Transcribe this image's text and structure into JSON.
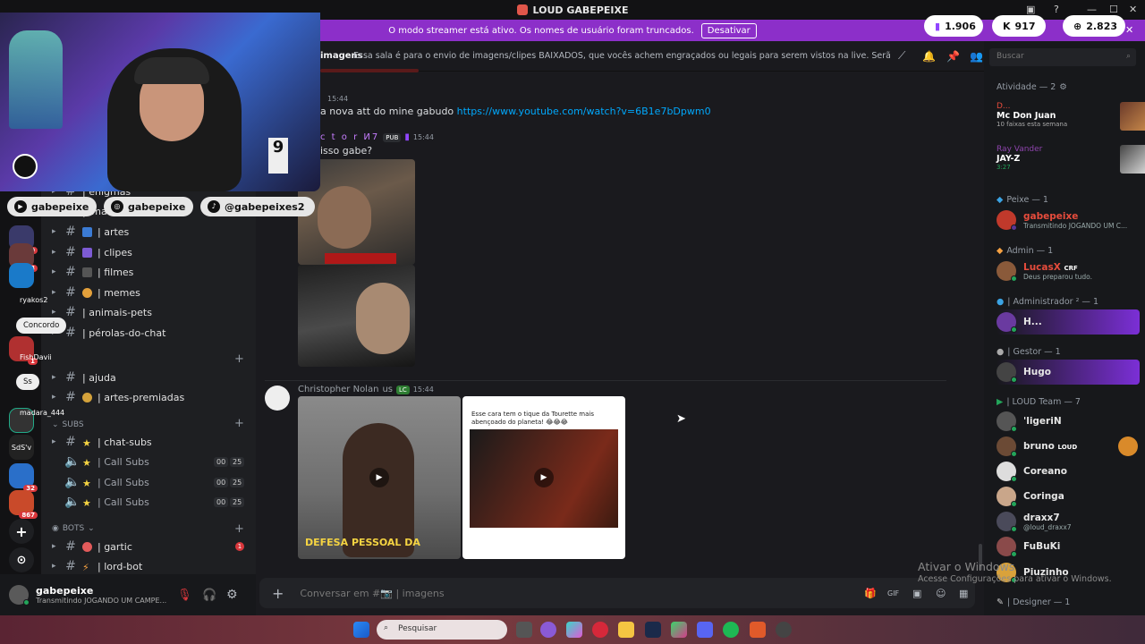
{
  "window": {
    "title": "LOUD GABEPEIXE"
  },
  "streamer_bar": {
    "message": "O modo streamer está ativo. Os nomes de usuário foram truncados.",
    "button": "Desativar"
  },
  "counters": [
    {
      "icon": "twitch-icon",
      "value": "1.906"
    },
    {
      "icon": "kick-icon",
      "value": "917"
    },
    {
      "icon": "globe-icon",
      "value": "2.823"
    }
  ],
  "channel_header": {
    "name": "imagens",
    "topic": "Essa sala é para o envio de imagens/clipes BAIXADOS, que vocês achem engraçados ou legais para serem vistos na live. Serão apagados prints de ou...",
    "search_placeholder": "Buscar"
  },
  "servers": {
    "badges": [
      "70",
      "113",
      "1",
      "32",
      "867"
    ],
    "labels": [
      "SdS'v"
    ]
  },
  "overlay": {
    "socials": [
      "gabepeixe",
      "gabepeixe",
      "@gabepeixes2"
    ],
    "chat": [
      {
        "user": "ryakos2"
      },
      {
        "text": "Concordo"
      },
      {
        "user": "FishDavii"
      },
      {
        "text": "Ss"
      },
      {
        "user": "madara_444"
      }
    ]
  },
  "channels": {
    "items": [
      {
        "name": "| enigmas"
      },
      {
        "name": "| ima..."
      },
      {
        "name": "| artes"
      },
      {
        "name": "| clipes"
      },
      {
        "name": "| filmes"
      },
      {
        "name": "| memes"
      },
      {
        "name": "| animais-pets"
      },
      {
        "name": "| pérolas-do-chat"
      },
      {
        "name": "| ajuda"
      },
      {
        "name": "| artes-premiadas"
      }
    ],
    "subs_category": "SUBS",
    "subs": [
      {
        "name": "| chat-subs"
      },
      {
        "name": "| Call Subs",
        "a": "00",
        "b": "25"
      },
      {
        "name": "| Call Subs",
        "a": "00",
        "b": "25"
      },
      {
        "name": "| Call Subs",
        "a": "00",
        "b": "25"
      }
    ],
    "bots_category": "BOTS",
    "bots": [
      {
        "name": "| gartic",
        "badge": "1"
      },
      {
        "name": "| lord-bot"
      }
    ]
  },
  "user": {
    "name": "gabepeixe",
    "status": "Transmitindo JOGANDO UM CAMPE..."
  },
  "messages": [
    {
      "time": "15:44",
      "text": "a nova att do mine gabudo ",
      "link": "https://www.youtube.com/watch?v=6B1e7bDpwm0"
    },
    {
      "author": "c t o r И7",
      "tag": "PUB",
      "time": "15:44",
      "text": "isso gabe?"
    },
    {
      "author": "Christopher Nolan",
      "suffix": "us",
      "tag": "LC",
      "time": "15:44",
      "image_caption": "Esse cara tem o tique da Tourette mais abençoado do planeta! 😂😂😂",
      "video_overlay": "DEFESA PESSOAL DA"
    }
  ],
  "composer": {
    "placeholder": "Conversar em #📷 | imagens"
  },
  "members": {
    "activity_title": "Atividade — 2",
    "activities": [
      {
        "name": "D...",
        "title": "Mc Don Juan",
        "sub": "10 faixas esta semana"
      },
      {
        "name": "Ray Vander",
        "title": "JAY-Z",
        "sub": "3:27"
      }
    ],
    "groups": [
      {
        "title": "Peixe — 1",
        "members": [
          {
            "name": "gabepeixe",
            "sub": "Transmitindo JOGANDO UM C...",
            "color": "#e74c3c"
          }
        ]
      },
      {
        "title": "Admin — 1",
        "members": [
          {
            "name": "LucasX",
            "tag": "CRF",
            "sub": "Deus preparou tudo.",
            "color": "#e74c3c"
          }
        ]
      },
      {
        "title": "| Administrador ² — 1",
        "members": [
          {
            "name": "H...",
            "color": "#ffffff"
          }
        ]
      },
      {
        "title": "| Gestor — 1",
        "members": [
          {
            "name": "Hugo",
            "color": "#ffffff"
          }
        ]
      },
      {
        "title": "| LOUD Team — 7",
        "members": [
          {
            "name": "'ligeriN",
            "color": "#dbdee1"
          },
          {
            "name": "bruno",
            "tag": "LOUD",
            "color": "#dbdee1"
          },
          {
            "name": "Coreano",
            "color": "#dbdee1"
          },
          {
            "name": "Coringa",
            "color": "#dbdee1"
          },
          {
            "name": "draxx7",
            "sub": "@loud_draxx7",
            "color": "#dbdee1"
          },
          {
            "name": "FuBuKi",
            "color": "#dbdee1"
          },
          {
            "name": "Piuzinho",
            "color": "#dbdee1"
          }
        ]
      },
      {
        "title": "| Designer — 1",
        "members": []
      }
    ]
  },
  "windows_watermark": {
    "line1": "Ativar o Windows",
    "line2": "Acesse Configurações para ativar o Windows."
  },
  "taskbar": {
    "search_placeholder": "Pesquisar"
  }
}
